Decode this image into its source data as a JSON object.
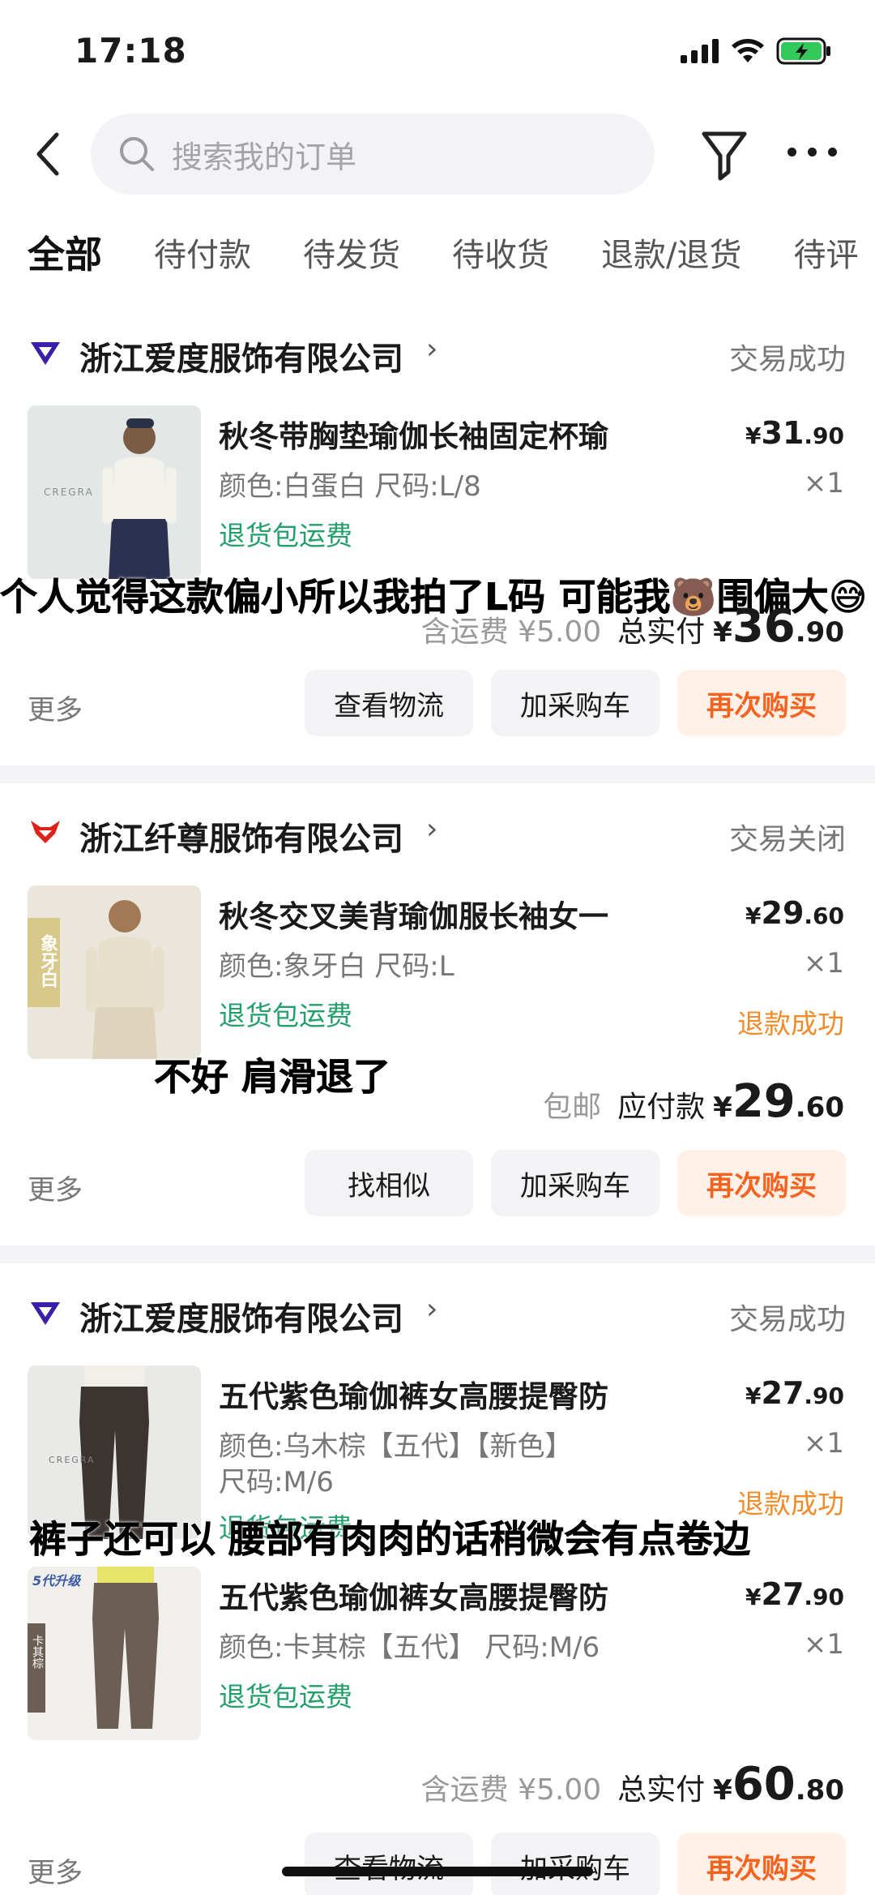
{
  "status_bar": {
    "time": "17:18"
  },
  "search": {
    "placeholder": "搜索我的订单"
  },
  "tabs": [
    "全部",
    "待付款",
    "待发货",
    "待收货",
    "退款/退货",
    "待评"
  ],
  "orders": [
    {
      "store": "浙江爱度服饰有限公司",
      "status": "交易成功",
      "items": [
        {
          "title": "秋冬带胸垫瑜伽长袖固定杯瑜",
          "attrs": "颜色:白蛋白 尺码:L/8",
          "tag": "退货包运费",
          "price_cur": "¥",
          "price_int": "31",
          "price_dec": ".90",
          "qty": "×1",
          "thumb_text": "CREGRA"
        }
      ],
      "total_prefix": "含运费 ¥5.00",
      "total_label": "总实付",
      "total_cur": "¥",
      "total_int": "36",
      "total_dec": ".90",
      "more": "更多",
      "buttons": [
        "查看物流",
        "加采购车",
        "再次购买"
      ]
    },
    {
      "store": "浙江纤尊服饰有限公司",
      "status": "交易关闭",
      "items": [
        {
          "title": "秋冬交叉美背瑜伽服长袖女一",
          "attrs": "颜色:象牙白 尺码:L",
          "tag": "退货包运费",
          "price_cur": "¥",
          "price_int": "29",
          "price_dec": ".60",
          "qty": "×1",
          "refund": "退款成功",
          "thumb_text": "象牙白"
        }
      ],
      "total_prefix": "包邮",
      "total_label": "应付款",
      "total_cur": "¥",
      "total_int": "29",
      "total_dec": ".60",
      "more": "更多",
      "buttons": [
        "找相似",
        "加采购车",
        "再次购买"
      ]
    },
    {
      "store": "浙江爱度服饰有限公司",
      "status": "交易成功",
      "items": [
        {
          "title": "五代紫色瑜伽裤女高腰提臀防",
          "attrs": "颜色:乌木棕【五代】【新色】",
          "attrs2": "尺码:M/6",
          "tag": "退货包运费",
          "price_cur": "¥",
          "price_int": "27",
          "price_dec": ".90",
          "qty": "×1",
          "refund": "退款成功",
          "thumb_text": "CREGRA"
        },
        {
          "title": "五代紫色瑜伽裤女高腰提臀防",
          "attrs": "颜色:卡其棕【五代】 尺码:M/6",
          "tag": "退货包运费",
          "price_cur": "¥",
          "price_int": "27",
          "price_dec": ".90",
          "qty": "×1",
          "thumb_text": "5代升级",
          "thumb_side": "卡其棕"
        }
      ],
      "total_prefix": "含运费 ¥5.00",
      "total_label": "总实付",
      "total_cur": "¥",
      "total_int": "60",
      "total_dec": ".80",
      "more": "更多",
      "buttons": [
        "查看物流",
        "加采购车",
        "再次购买"
      ]
    }
  ],
  "overlays": [
    "个人觉得这款偏小所以我拍了L码 可能我🐻围偏大😅",
    "不好 肩滑退了",
    "裤子还可以 腰部有肉肉的话稍微会有点卷边"
  ],
  "colors": {
    "accent": "#f5631f",
    "accent_bg": "#fff1e8",
    "green": "#22a06b",
    "refund_orange": "#f28c28",
    "logo_purple": "#3b1fa8",
    "logo_red": "#e0231a"
  }
}
